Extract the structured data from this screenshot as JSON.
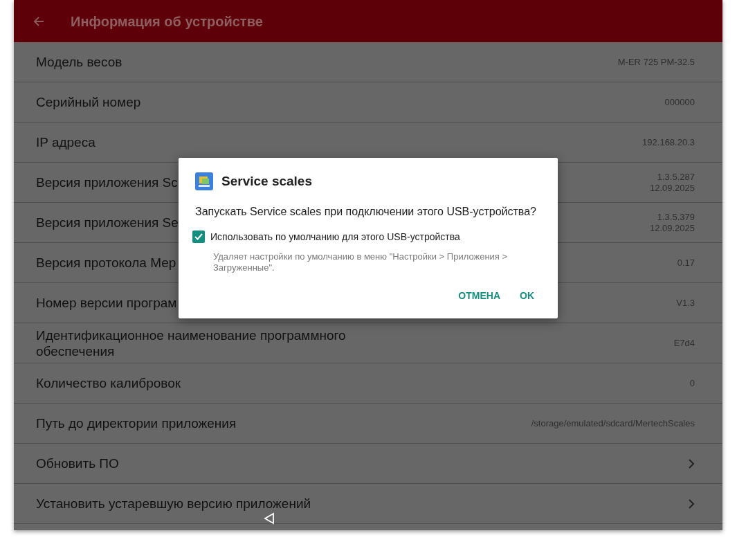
{
  "app_bar": {
    "title": "Информация об устройстве"
  },
  "rows": [
    {
      "kind": "value",
      "label": "Модель весов",
      "value": [
        "M-ER 725 PM-32.5"
      ]
    },
    {
      "kind": "value",
      "label": "Серийный номер",
      "value": [
        "000000"
      ]
    },
    {
      "kind": "value",
      "label": "IP адреса",
      "value": [
        "192.168.20.3"
      ]
    },
    {
      "kind": "value",
      "label": "Версия приложения Sc",
      "value": [
        "1.3.5.287",
        "12.09.2025"
      ]
    },
    {
      "kind": "value",
      "label": "Версия приложения Se",
      "value": [
        "1.3.5.379",
        "12.09.2025"
      ]
    },
    {
      "kind": "value",
      "label": "Версия протокола Мер",
      "value": [
        "0.17"
      ]
    },
    {
      "kind": "value",
      "label": "Номер версии програм",
      "value": [
        "V1.3"
      ]
    },
    {
      "kind": "value",
      "label": "Идентификационное наименование программного обеспечения",
      "value": [
        "E7d4"
      ]
    },
    {
      "kind": "value",
      "label": "Количество калибровок",
      "value": [
        "0"
      ]
    },
    {
      "kind": "value",
      "label": "Путь до директории приложения",
      "value": [
        "/storage/emulated/sdcard/MertechScales"
      ]
    },
    {
      "kind": "link",
      "label": "Обновить ПО"
    },
    {
      "kind": "link",
      "label": "Установить устаревшую версию приложений"
    }
  ],
  "dialog": {
    "title": "Service scales",
    "message": "Запускать Service scales при подключении этого USB-устройства?",
    "checkbox": {
      "label": "Использовать по умолчанию для этого USB-устройства",
      "checked": true
    },
    "hint": "Удаляет настройки по умолчанию в меню \"Настройки > Приложения > Загруженные\".",
    "buttons": [
      "ОТМЕНА",
      "OK"
    ]
  }
}
